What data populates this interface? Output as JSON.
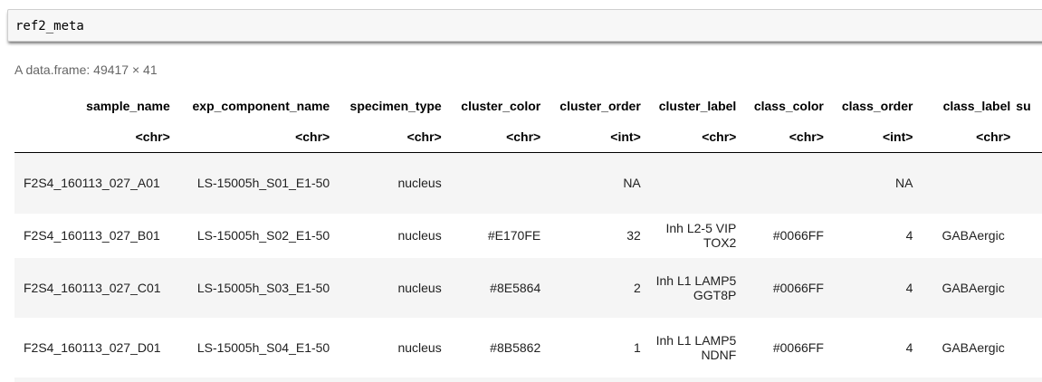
{
  "cell": {
    "code": "ref2_meta"
  },
  "output": {
    "caption": "A data.frame: 49417 × 41",
    "columns": [
      {
        "name": "sample_name",
        "type": "<chr>"
      },
      {
        "name": "exp_component_name",
        "type": "<chr>"
      },
      {
        "name": "specimen_type",
        "type": "<chr>"
      },
      {
        "name": "cluster_color",
        "type": "<chr>"
      },
      {
        "name": "cluster_order",
        "type": "<int>"
      },
      {
        "name": "cluster_label",
        "type": "<chr>"
      },
      {
        "name": "class_color",
        "type": "<chr>"
      },
      {
        "name": "class_order",
        "type": "<int>"
      },
      {
        "name": "class_label",
        "type": "<chr>"
      },
      {
        "name": "su",
        "type": ""
      }
    ],
    "rows": [
      [
        "F2S4_160113_027_A01",
        "LS-15005h_S01_E1-50",
        "nucleus",
        "",
        "NA",
        "",
        "",
        "NA",
        "",
        ""
      ],
      [
        "F2S4_160113_027_B01",
        "LS-15005h_S02_E1-50",
        "nucleus",
        "#E170FE",
        "32",
        "Inh L2-5 VIP TOX2",
        "#0066FF",
        "4",
        "GABAergic",
        ""
      ],
      [
        "F2S4_160113_027_C01",
        "LS-15005h_S03_E1-50",
        "nucleus",
        "#8E5864",
        "2",
        "Inh L1 LAMP5 GGT8P",
        "#0066FF",
        "4",
        "GABAergic",
        ""
      ],
      [
        "F2S4_160113_027_D01",
        "LS-15005h_S04_E1-50",
        "nucleus",
        "#8B5862",
        "1",
        "Inh L1 LAMP5 NDNF",
        "#0066FF",
        "4",
        "GABAergic",
        ""
      ]
    ]
  }
}
